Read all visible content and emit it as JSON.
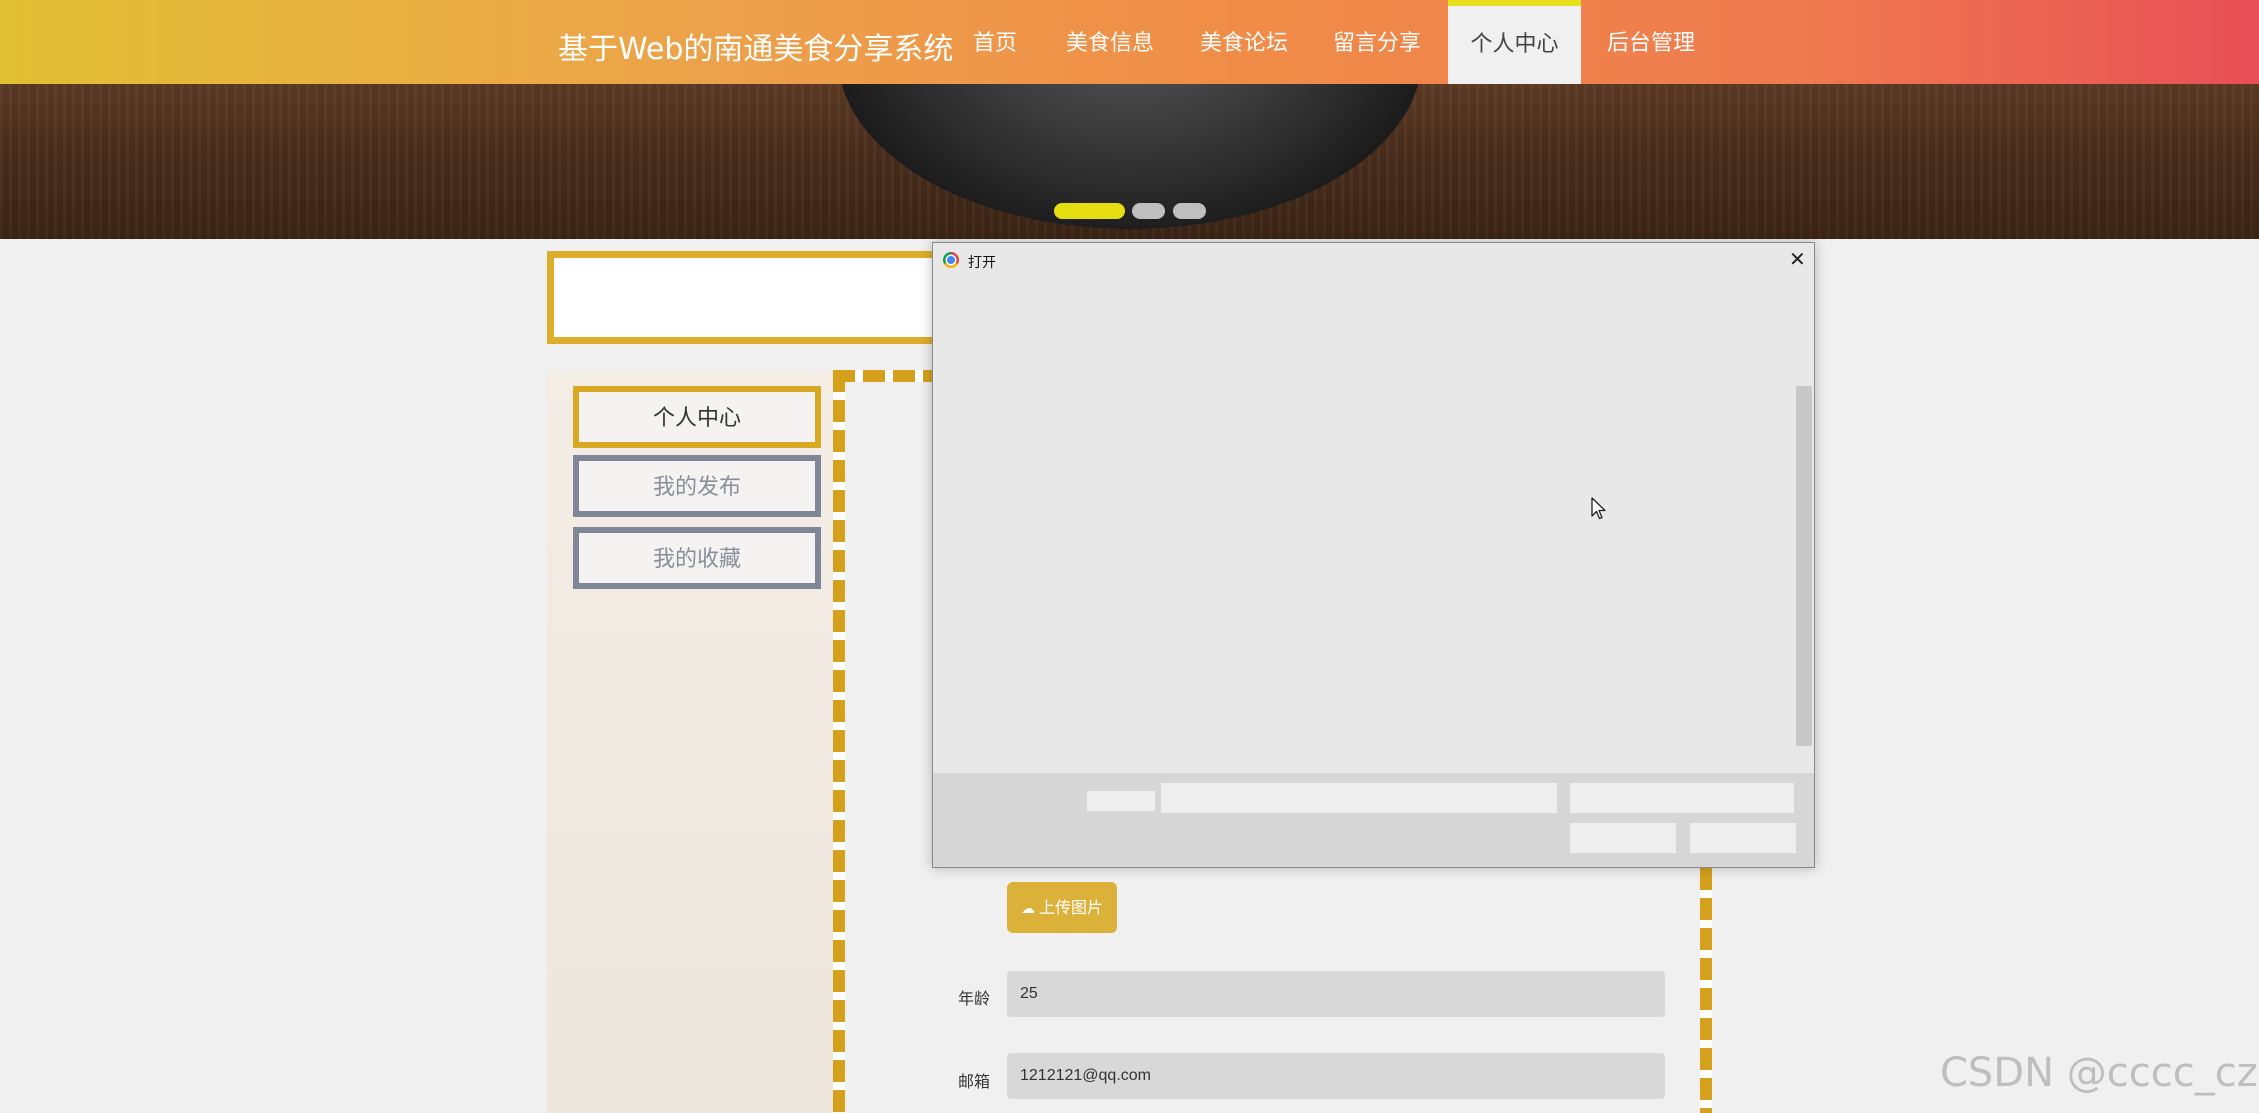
{
  "header": {
    "site_title": "基于Web的南通美食分享系统",
    "nav": [
      "首页",
      "美食信息",
      "美食论坛",
      "留言分享",
      "个人中心",
      "后台管理"
    ],
    "active_nav": "个人中心"
  },
  "carousel": {
    "slide_count": 3,
    "active_index": 0
  },
  "sidebar": {
    "items": [
      "个人中心",
      "我的发布",
      "我的收藏"
    ],
    "active": "个人中心"
  },
  "form": {
    "upload_label": "上传图片",
    "age_label": "年龄",
    "age_value": "25",
    "email_label": "邮箱",
    "email_value": "1212121@qq.com"
  },
  "dialog": {
    "title": "打开"
  },
  "watermark": "CSDN @cccc_cz",
  "colors": {
    "accent_yellow": "#ddae2c",
    "nav_gradient_start": "#e1c034",
    "nav_gradient_end": "#e84f57",
    "sidebar_inactive_border": "#7e8697"
  }
}
